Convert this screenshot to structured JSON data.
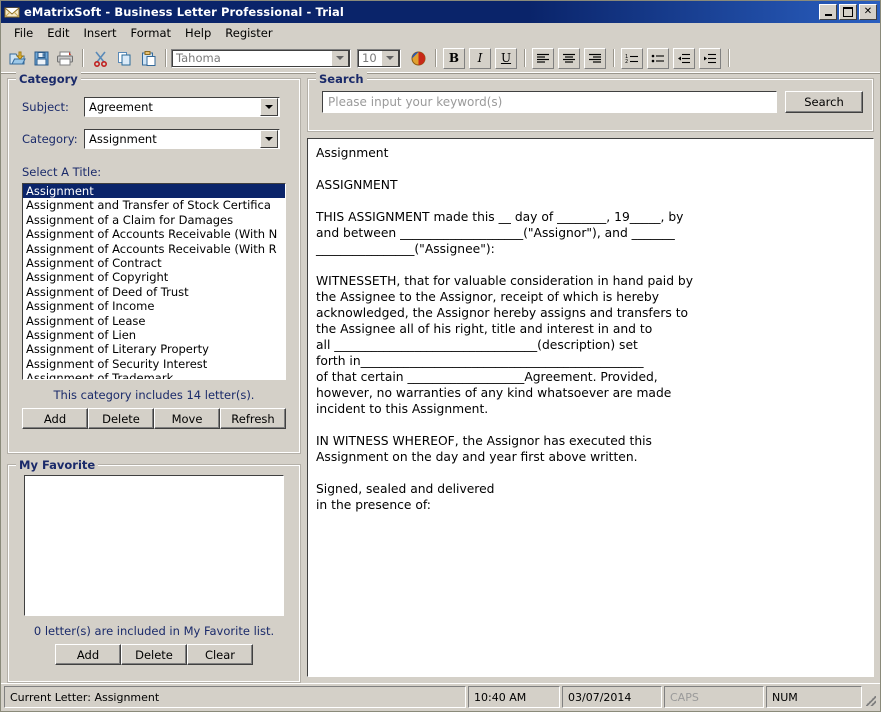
{
  "window": {
    "title": "eMatrixSoft - Business Letter Professional - Trial",
    "icon": "envelope-icon",
    "controls": {
      "minimize": "_",
      "maximize": "□",
      "close": "✕"
    }
  },
  "menubar": [
    "File",
    "Edit",
    "Insert",
    "Format",
    "Help",
    "Register"
  ],
  "toolbar": {
    "file_icons": [
      "open-icon",
      "save-icon",
      "print-icon"
    ],
    "clipboard_icons": [
      "cut-icon",
      "copy-icon",
      "paste-icon"
    ],
    "font_name": "Tahoma",
    "font_size": "10",
    "color_icon": "font-color-icon",
    "format_buttons": [
      {
        "name": "bold-button",
        "label": "B"
      },
      {
        "name": "italic-button",
        "label": "I"
      },
      {
        "name": "underline-button",
        "label": "U"
      }
    ],
    "align_buttons": [
      "align-left-icon",
      "align-center-icon",
      "align-right-icon"
    ],
    "list_buttons": [
      "numbered-list-icon",
      "bulleted-list-icon",
      "decrease-indent-icon",
      "increase-indent-icon"
    ]
  },
  "category": {
    "legend": "Category",
    "subject_label": "Subject:",
    "subject_value": "Agreement",
    "category_label": "Category:",
    "category_value": "Assignment",
    "select_title_label": "Select A Title:",
    "titles": [
      "Assignment",
      "Assignment and Transfer of Stock Certifica",
      "Assignment of a Claim for Damages",
      "Assignment of Accounts Receivable (With N",
      "Assignment of Accounts Receivable (With R",
      "Assignment of Contract",
      "Assignment of Copyright",
      "Assignment of Deed of Trust",
      "Assignment of Income",
      "Assignment of Lease",
      "Assignment of Lien",
      "Assignment of Literary Property",
      "Assignment of Security Interest",
      "Assignment of Trademark"
    ],
    "selected_index": 0,
    "count_text": "This category includes 14 letter(s).",
    "buttons": [
      "Add",
      "Delete",
      "Move",
      "Refresh"
    ]
  },
  "favorite": {
    "legend": "My Favorite",
    "items": [],
    "count_text": "0 letter(s) are included in My Favorite list.",
    "buttons": [
      "Add",
      "Delete",
      "Clear"
    ]
  },
  "search": {
    "legend": "Search",
    "placeholder": "Please input your keyword(s)",
    "value": "",
    "button_label": "Search"
  },
  "document": {
    "text": "Assignment\n\nASSIGNMENT\n\nTHIS ASSIGNMENT made this __ day of ________, 19_____, by\nand between ____________________(\"Assignor\"), and _______\n________________(\"Assignee\"):\n\nWITNESSETH, that for valuable consideration in hand paid by\nthe Assignee to the Assignor, receipt of which is hereby\nacknowledged, the Assignor hereby assigns and transfers to\nthe Assignee all of his right, title and interest in and to\nall _________________________________(description) set\nforth in______________________________________________\nof that certain ___________________Agreement. Provided,\nhowever, no warranties of any kind whatsoever are made\nincident to this Assignment.\n\nIN WITNESS WHEREOF, the Assignor has executed this\nAssignment on the day and year first above written.\n\nSigned, sealed and delivered\nin the presence of:"
  },
  "statusbar": {
    "current_letter": "Current Letter: Assignment",
    "time": "10:40 AM",
    "date": "03/07/2014",
    "caps": "CAPS",
    "num": "NUM"
  }
}
